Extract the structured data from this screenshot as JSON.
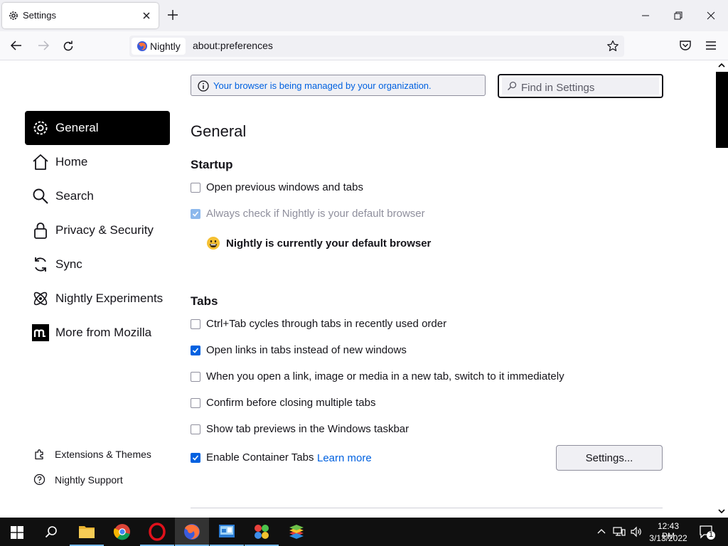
{
  "tab": {
    "title": "Settings"
  },
  "urlbar": {
    "identity_label": "Nightly",
    "url": "about:preferences"
  },
  "managed_notice": "Your browser is being managed by your organization.",
  "find": {
    "placeholder": "Find in Settings"
  },
  "sidebar": {
    "items": [
      {
        "label": "General",
        "icon": "gear-icon",
        "active": true
      },
      {
        "label": "Home",
        "icon": "home-icon"
      },
      {
        "label": "Search",
        "icon": "search-icon"
      },
      {
        "label": "Privacy & Security",
        "icon": "lock-icon"
      },
      {
        "label": "Sync",
        "icon": "sync-icon"
      },
      {
        "label": "Nightly Experiments",
        "icon": "experiments-icon"
      },
      {
        "label": "More from Mozilla",
        "icon": "mozilla-icon"
      }
    ],
    "footer": [
      {
        "label": "Extensions & Themes",
        "icon": "puzzle-icon"
      },
      {
        "label": "Nightly Support",
        "icon": "help-icon"
      }
    ]
  },
  "main": {
    "heading": "General",
    "startup": {
      "heading": "Startup",
      "options": [
        {
          "label": "Open previous windows and tabs",
          "checked": false,
          "disabled": false
        },
        {
          "label": "Always check if Nightly is your default browser",
          "checked": true,
          "disabled": true
        }
      ],
      "default_status": "Nightly is currently your default browser"
    },
    "tabs": {
      "heading": "Tabs",
      "options": [
        {
          "label": "Ctrl+Tab cycles through tabs in recently used order",
          "checked": false
        },
        {
          "label": "Open links in tabs instead of new windows",
          "checked": true
        },
        {
          "label": "When you open a link, image or media in a new tab, switch to it immediately",
          "checked": false
        },
        {
          "label": "Confirm before closing multiple tabs",
          "checked": false
        },
        {
          "label": "Show tab previews in the Windows taskbar",
          "checked": false
        },
        {
          "label": "Enable Container Tabs",
          "checked": true
        }
      ],
      "learn_more": "Learn more",
      "settings_button": "Settings..."
    }
  },
  "taskbar": {
    "apps": [
      "file-explorer",
      "chrome",
      "opera",
      "firefox-nightly",
      "control-panel",
      "photos",
      "bluestacks"
    ],
    "active_app": "firefox-nightly",
    "time": "12:43 PM",
    "date": "3/13/2022",
    "notification_count": "1"
  },
  "colors": {
    "accent": "#0061e0",
    "active_nav_bg": "#000000"
  }
}
